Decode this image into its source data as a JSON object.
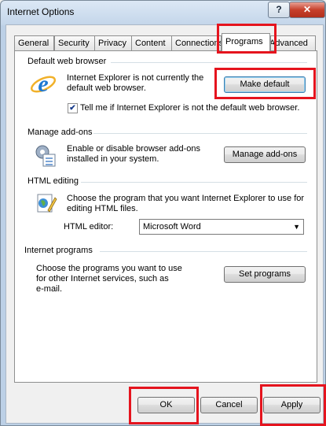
{
  "window": {
    "title": "Internet Options",
    "help_label": "?",
    "close_label": "✕"
  },
  "tabs": [
    {
      "label": "General"
    },
    {
      "label": "Security"
    },
    {
      "label": "Privacy"
    },
    {
      "label": "Content"
    },
    {
      "label": "Connections"
    },
    {
      "label": "Programs"
    },
    {
      "label": "Advanced"
    }
  ],
  "default_browser": {
    "heading": "Default web browser",
    "status_line1": "Internet Explorer is not currently the",
    "status_line2": "default web browser.",
    "make_default_label": "Make default",
    "tell_me_label": "Tell me if Internet Explorer is not the default web browser.",
    "tell_me_checked": true
  },
  "addons": {
    "heading": "Manage add-ons",
    "desc_line1": "Enable or disable browser add-ons",
    "desc_line2": "installed in your system.",
    "button_label": "Manage add-ons"
  },
  "html_editing": {
    "heading": "HTML editing",
    "desc_line1": "Choose the program that you want Internet Explorer to use for",
    "desc_line2": "editing HTML files.",
    "editor_label": "HTML editor:",
    "editor_value": "Microsoft Word"
  },
  "internet_programs": {
    "heading": "Internet programs",
    "desc_line1": "Choose the programs you want to use",
    "desc_line2": "for other Internet services, such as",
    "desc_line3": "e-mail.",
    "button_label": "Set programs"
  },
  "footer": {
    "ok_label": "OK",
    "cancel_label": "Cancel",
    "apply_label": "Apply"
  },
  "colors": {
    "highlight": "#e5141e",
    "ie_blue": "#1e78d2"
  },
  "icons": [
    "internet-explorer-icon",
    "addons-gear-icon",
    "html-editor-icon"
  ]
}
